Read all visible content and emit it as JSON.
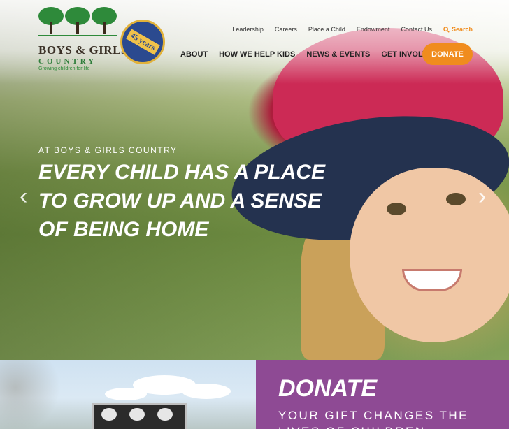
{
  "logo": {
    "name": "BOYS & GIRLS",
    "country": "COUNTRY",
    "tagline": "Growing children for life",
    "seal": "45 years"
  },
  "utility_nav": {
    "items": [
      "Leadership",
      "Careers",
      "Place a Child",
      "Endowment",
      "Contact Us"
    ],
    "search": "Search"
  },
  "main_nav": {
    "items": [
      "ABOUT",
      "HOW WE HELP KIDS",
      "NEWS & EVENTS",
      "GET INVOLVED"
    ],
    "donate": "DONATE"
  },
  "hero": {
    "eyebrow": "AT BOYS & GIRLS COUNTRY",
    "headline": "EVERY CHILD HAS A PLACE TO GROW UP AND A SENSE OF BEING HOME",
    "prev": "‹",
    "next": "›"
  },
  "promo": {
    "title": "DONATE",
    "subtitle": "YOUR GIFT CHANGES THE LIVES OF CHILDREN"
  },
  "colors": {
    "accent": "#f08c1e",
    "purple": "#8e4a94",
    "green": "#2e8a3a"
  }
}
